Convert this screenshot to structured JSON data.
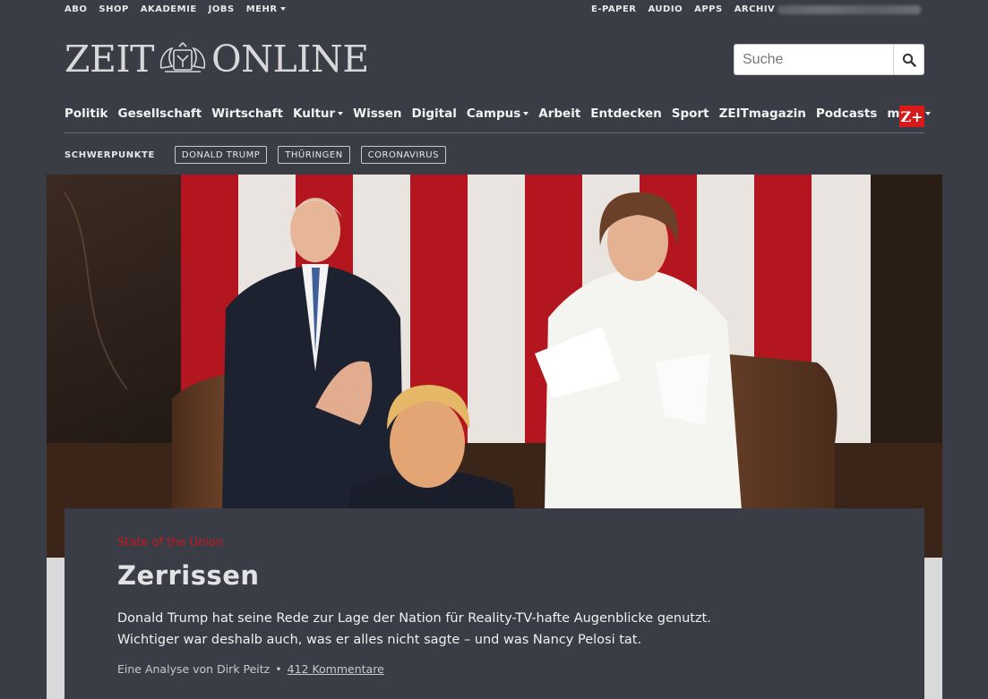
{
  "topbar": {
    "left": [
      "ABO",
      "SHOP",
      "AKADEMIE",
      "JOBS"
    ],
    "mehr": "MEHR",
    "right": [
      "E-PAPER",
      "AUDIO",
      "APPS",
      "ARCHIV"
    ]
  },
  "logo": {
    "left": "ZEIT",
    "right": "ONLINE"
  },
  "search": {
    "placeholder": "Suche",
    "icon": "search-icon"
  },
  "nav": {
    "items": [
      "Politik",
      "Gesellschaft",
      "Wirtschaft",
      "Kultur",
      "Wissen",
      "Digital",
      "Campus",
      "Arbeit",
      "Entdecken",
      "Sport",
      "ZEITmagazin",
      "Podcasts",
      "mehr"
    ],
    "zplus": "Z+"
  },
  "schwerpunkte": {
    "label": "SCHWERPUNKTE",
    "topics": [
      "DONALD TRUMP",
      "THÜRINGEN",
      "CORONAVIRUS"
    ]
  },
  "article": {
    "kicker": "State of the Union",
    "headline": "Zerrissen",
    "summary": "Donald Trump hat seine Rede zur Lage der Nation für Reality-TV-hafte Augenblicke genutzt. Wichtiger war deshalb auch, was er alles nicht sagte – und was Nancy Pelosi tat.",
    "byline": "Eine Analyse von Dirk Peitz",
    "separator": "•",
    "comments": "412 Kommentare"
  },
  "colors": {
    "header_bg": "#3a3d45",
    "accent_red": "#c8161d",
    "zplus_red": "#d61a1a"
  }
}
